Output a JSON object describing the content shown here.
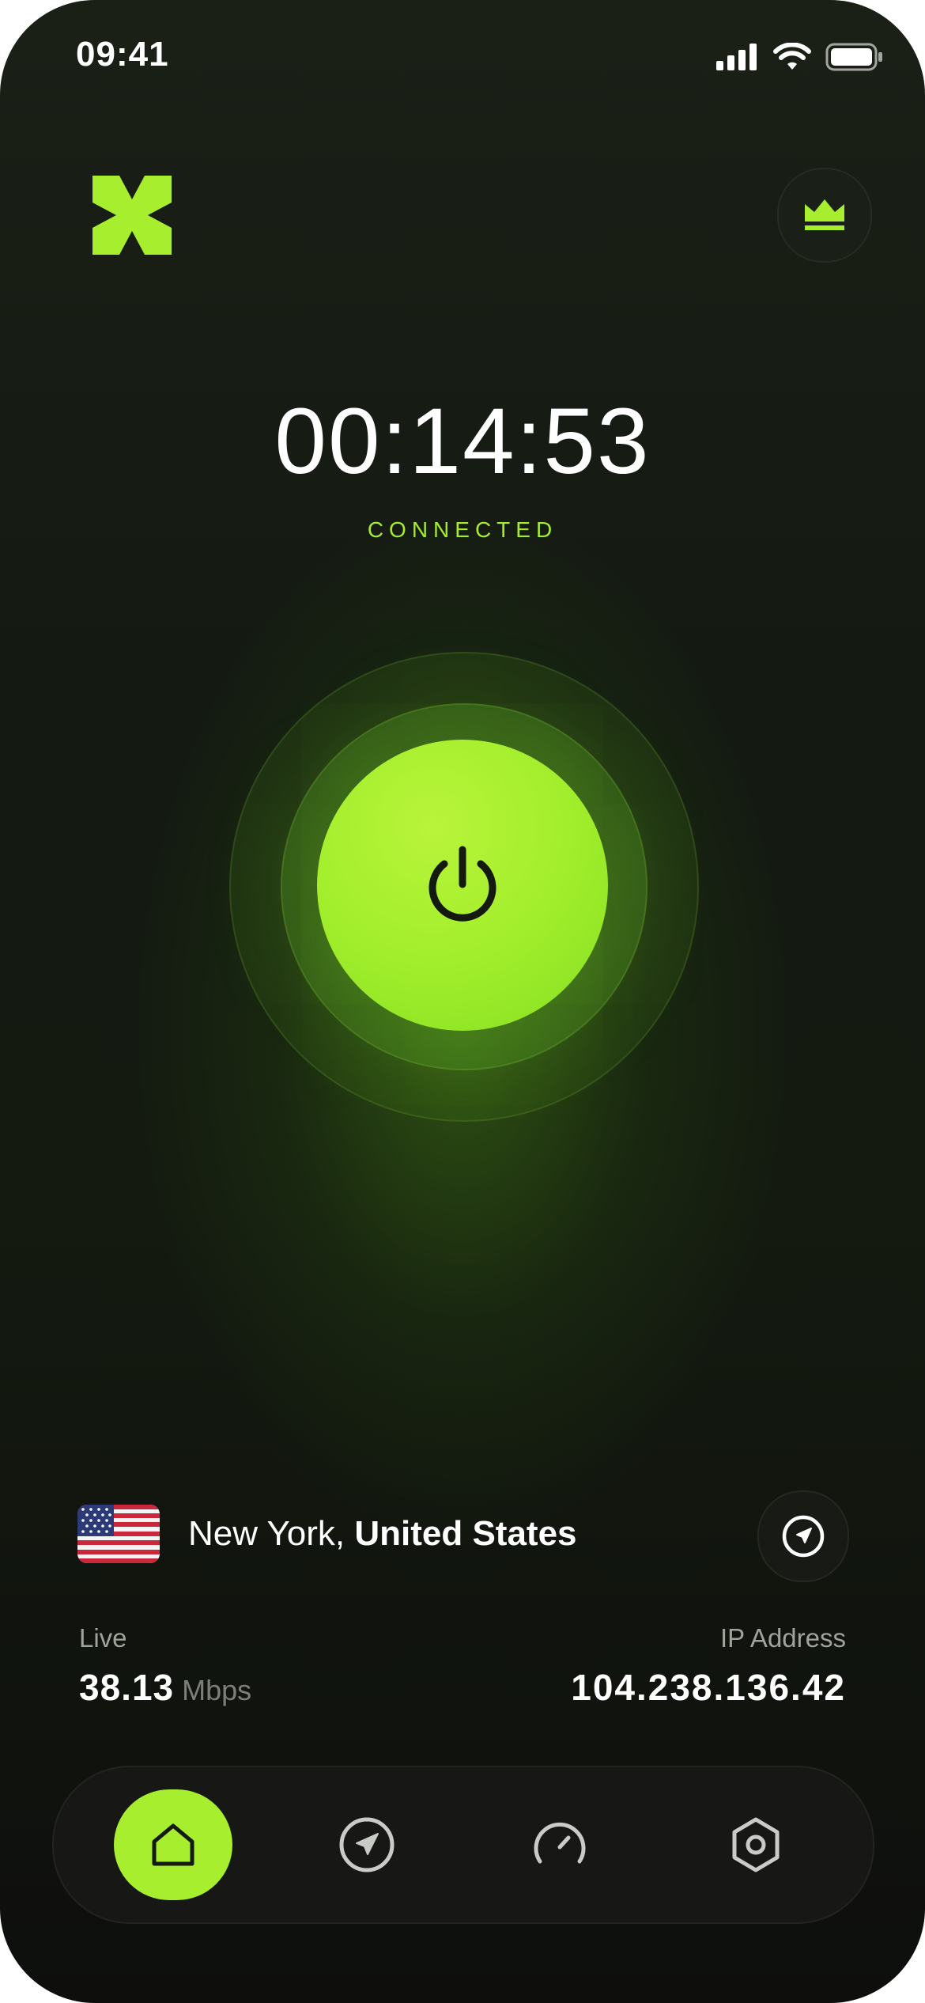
{
  "status_bar": {
    "time": "09:41"
  },
  "header": {
    "logo_icon": "x-logo-icon",
    "premium_icon": "crown-icon"
  },
  "connection": {
    "timer": "00:14:53",
    "status": "CONNECTED",
    "power_icon": "power-icon"
  },
  "location": {
    "city": "New York, ",
    "country": "United States",
    "flag_icon": "us-flag-icon",
    "locate_icon": "navigation-arrow-icon"
  },
  "stats": {
    "live_label": "Live",
    "live_value": "38.13",
    "live_unit": "Mbps",
    "ip_label": "IP Address",
    "ip_value": "104.238.136.42"
  },
  "tabbar": {
    "tabs": [
      {
        "name": "home",
        "icon": "home-icon",
        "active": true
      },
      {
        "name": "locations",
        "icon": "navigation-arrow-icon",
        "active": false
      },
      {
        "name": "speed",
        "icon": "speedometer-icon",
        "active": false
      },
      {
        "name": "settings",
        "icon": "hexagon-settings-icon",
        "active": false
      }
    ]
  },
  "colors": {
    "accent": "#a6ee2e",
    "background": "#141a12",
    "text": "#ffffff",
    "muted": "#a0a39b"
  }
}
